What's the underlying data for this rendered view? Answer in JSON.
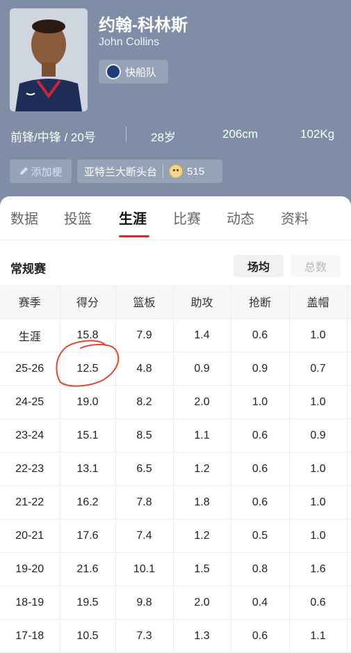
{
  "player": {
    "name_cn": "约翰-科林斯",
    "name_en": "John Collins",
    "team": "快船队",
    "position": "前锋/中锋 / 20号",
    "age": "28岁",
    "height": "206cm",
    "weight": "102Kg"
  },
  "chips": {
    "add_nickname": "添加梗",
    "nickname": "亚特兰大断头台",
    "nickname_count": "515"
  },
  "tabs": [
    "数据",
    "投篮",
    "生涯",
    "比赛",
    "动态",
    "资料"
  ],
  "active_tab": "生涯",
  "section": {
    "title": "常规赛",
    "toggle_avg": "场均",
    "toggle_total": "总数"
  },
  "table": {
    "headers": [
      "赛季",
      "得分",
      "篮板",
      "助攻",
      "抢断",
      "盖帽"
    ],
    "rows": [
      [
        "生涯",
        "15.8",
        "7.9",
        "1.4",
        "0.6",
        "1.0"
      ],
      [
        "25-26",
        "12.5",
        "4.8",
        "0.9",
        "0.9",
        "0.7"
      ],
      [
        "24-25",
        "19.0",
        "8.2",
        "2.0",
        "1.0",
        "1.0"
      ],
      [
        "23-24",
        "15.1",
        "8.5",
        "1.1",
        "0.6",
        "0.9"
      ],
      [
        "22-23",
        "13.1",
        "6.5",
        "1.2",
        "0.6",
        "1.0"
      ],
      [
        "21-22",
        "16.2",
        "7.8",
        "1.8",
        "0.6",
        "1.0"
      ],
      [
        "20-21",
        "17.6",
        "7.4",
        "1.2",
        "0.5",
        "1.0"
      ],
      [
        "19-20",
        "21.6",
        "10.1",
        "1.5",
        "0.8",
        "1.6"
      ],
      [
        "18-19",
        "19.5",
        "9.8",
        "2.0",
        "0.4",
        "0.6"
      ],
      [
        "17-18",
        "10.5",
        "7.3",
        "1.3",
        "0.6",
        "1.1"
      ]
    ]
  },
  "colors": {
    "header_bg": "#7f8ea6",
    "accent_red": "#e02a2a",
    "annotation": "#e8432b"
  }
}
